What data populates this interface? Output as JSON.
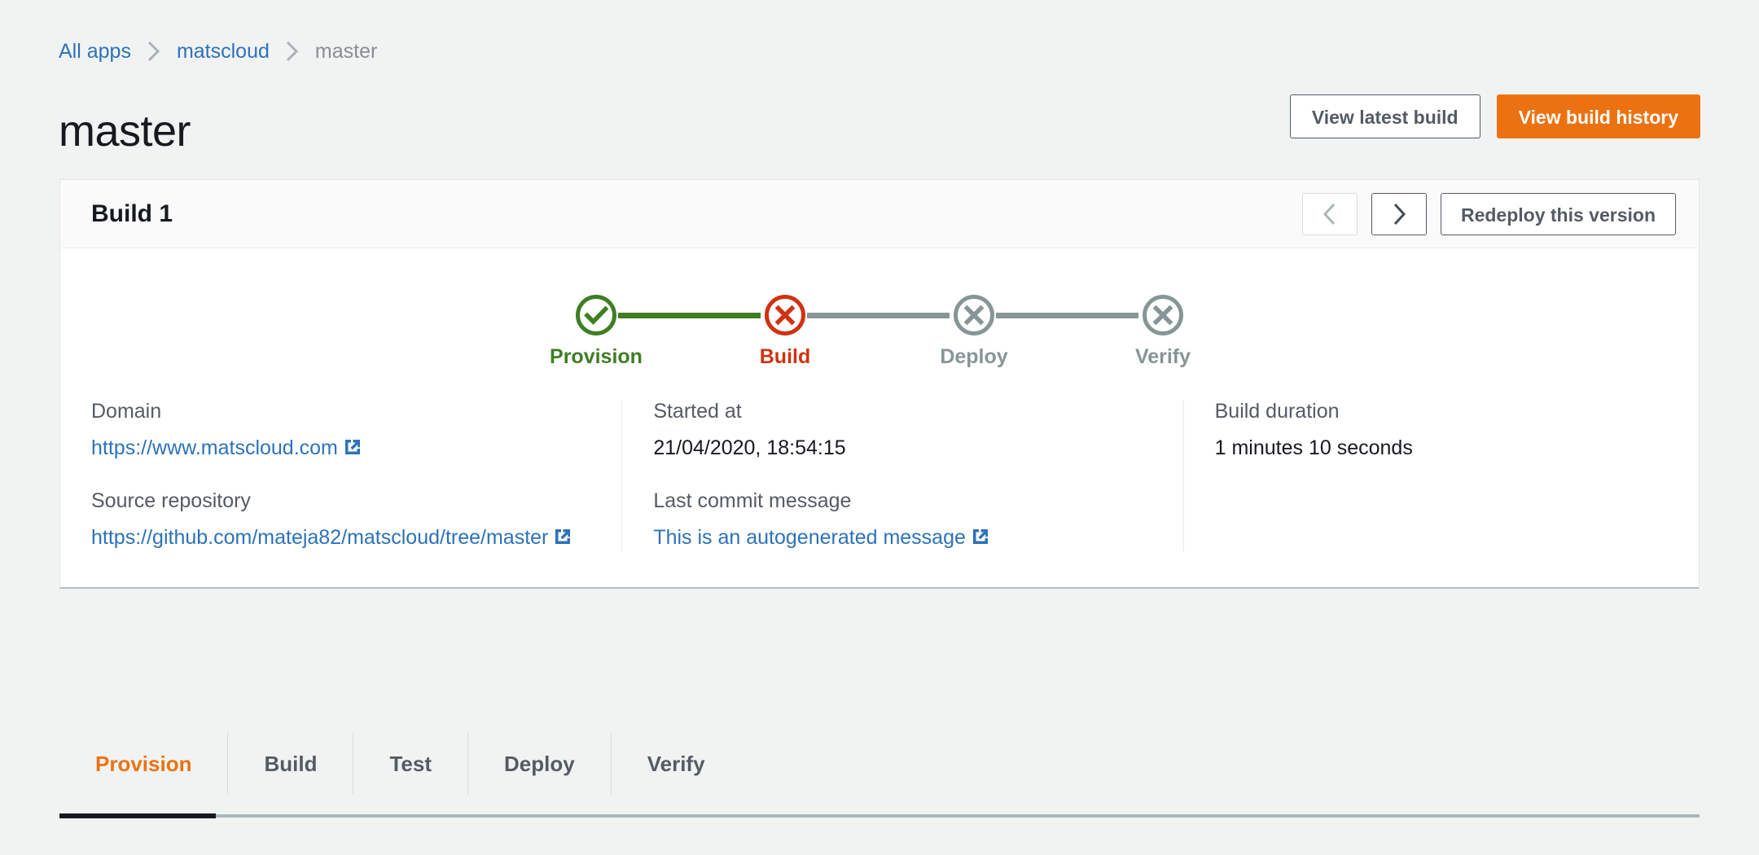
{
  "breadcrumb": {
    "items": [
      {
        "label": "All apps",
        "type": "link"
      },
      {
        "label": "matscloud",
        "type": "link"
      },
      {
        "label": "master",
        "type": "current"
      }
    ],
    "separator_icon": "chevron-right-icon"
  },
  "header": {
    "title": "master",
    "view_latest_build_label": "View latest build",
    "view_build_history_label": "View build history",
    "primary_color": "#ec7211"
  },
  "build_card": {
    "title": "Build 1",
    "prev_icon": "chevron-left-icon",
    "next_icon": "chevron-right-icon",
    "prev_disabled": true,
    "next_disabled": false,
    "redeploy_label": "Redeploy this version"
  },
  "stepper": {
    "steps": [
      {
        "label": "Provision",
        "state": "success",
        "icon": "check-circle-icon",
        "color": "#3f7e23"
      },
      {
        "label": "Build",
        "state": "failed",
        "icon": "x-circle-icon",
        "color": "#d13212"
      },
      {
        "label": "Deploy",
        "state": "skipped",
        "icon": "x-circle-icon",
        "color": "#879596"
      },
      {
        "label": "Verify",
        "state": "skipped",
        "icon": "x-circle-icon",
        "color": "#879596"
      }
    ],
    "connectors": [
      {
        "color": "#3f7e23"
      },
      {
        "color": "#879596"
      },
      {
        "color": "#879596"
      }
    ]
  },
  "details": {
    "columns": [
      {
        "blocks": [
          {
            "label": "Domain",
            "value": "https://www.matscloud.com",
            "is_link": true,
            "external_icon": "external-link-icon"
          },
          {
            "label": "Source repository",
            "value": "https://github.com/mateja82/matscloud/tree/master",
            "is_link": true,
            "external_icon": "external-link-icon"
          }
        ]
      },
      {
        "blocks": [
          {
            "label": "Started at",
            "value": "21/04/2020, 18:54:15",
            "is_link": false
          },
          {
            "label": "Last commit message",
            "value": "This is an autogenerated message",
            "is_link": true,
            "external_icon": "external-link-icon"
          }
        ]
      },
      {
        "blocks": [
          {
            "label": "Build duration",
            "value": "1 minutes 10 seconds",
            "is_link": false
          }
        ]
      }
    ]
  },
  "tabs": {
    "items": [
      {
        "label": "Provision",
        "active": true
      },
      {
        "label": "Build",
        "active": false
      },
      {
        "label": "Test",
        "active": false
      },
      {
        "label": "Deploy",
        "active": false
      },
      {
        "label": "Verify",
        "active": false
      }
    ],
    "active_color": "#ec7211",
    "underline_color": "#16191f"
  }
}
